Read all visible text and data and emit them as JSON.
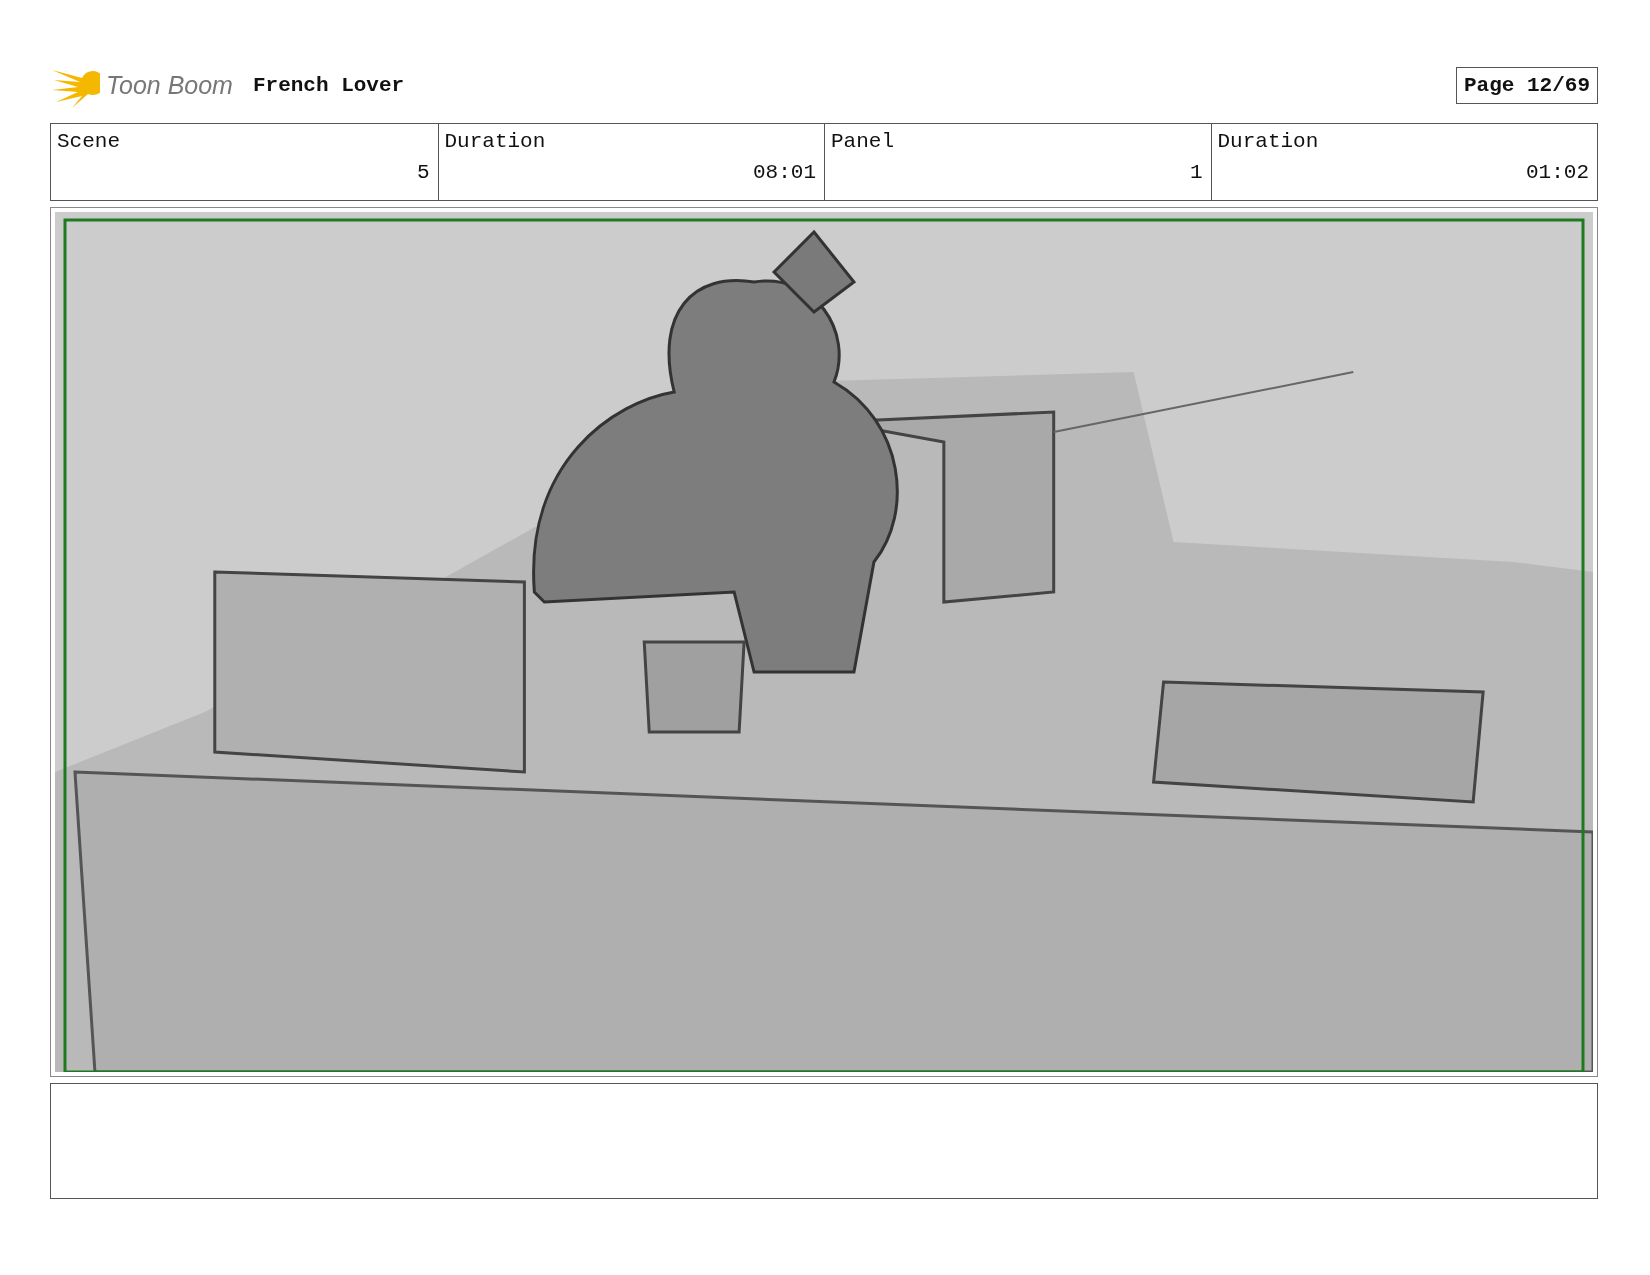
{
  "header": {
    "logo": "Toon Boom",
    "project": "French Lover",
    "page": "Page 12/69"
  },
  "info_table": {
    "columns": [
      "Scene",
      "Duration",
      "Panel",
      "Duration"
    ],
    "rows": [
      [
        "5",
        "08:01",
        "1",
        "01:02"
      ]
    ]
  }
}
